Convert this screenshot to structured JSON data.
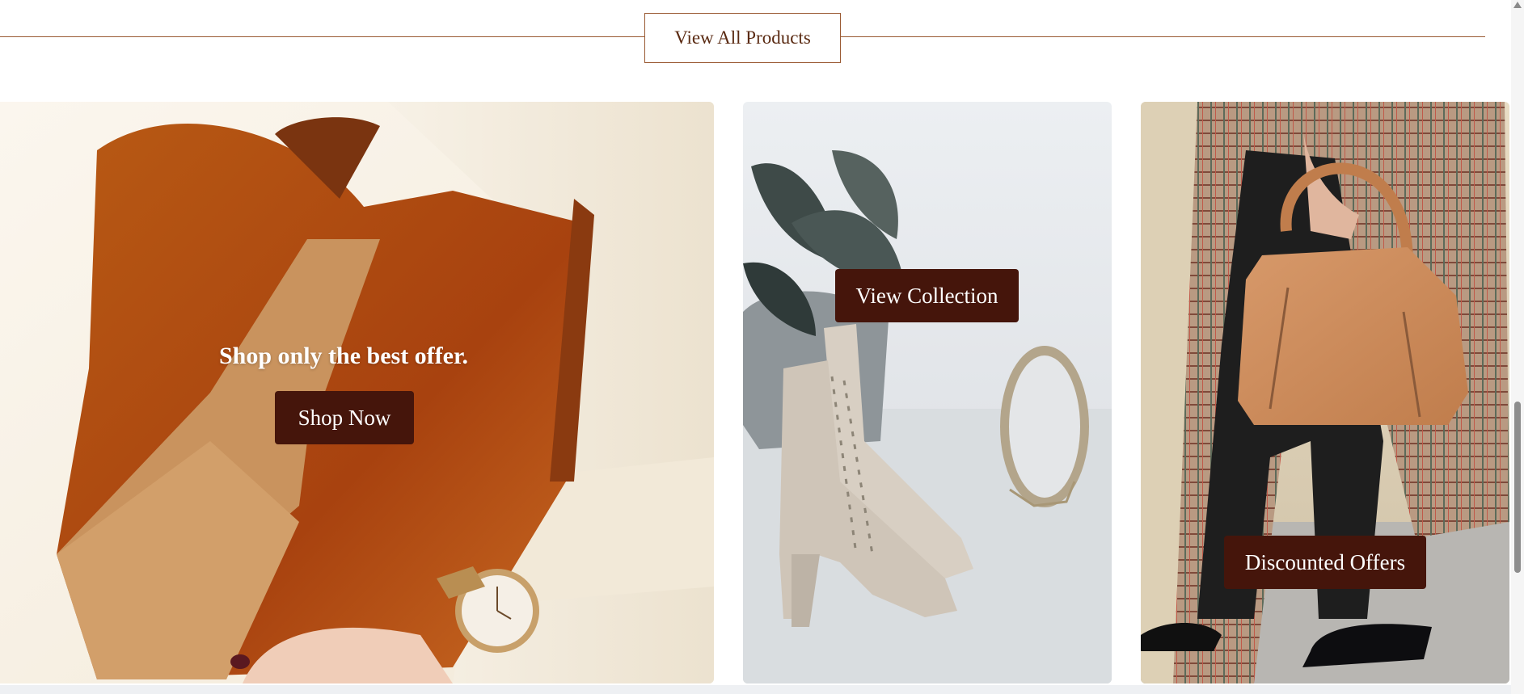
{
  "section": {
    "view_all_label": "View All Products"
  },
  "cards": [
    {
      "id": "best-offer",
      "title": "Shop only the best offer.",
      "button_label": "Shop Now",
      "image": "bucket-bag-wristwatch-photo"
    },
    {
      "id": "collection",
      "button_label": "View Collection",
      "image": "suede-lace-up-boots-mirror-photo"
    },
    {
      "id": "discounts",
      "button_label": "Discounted Offers",
      "image": "tan-handbag-plaid-coat-photo"
    }
  ],
  "colors": {
    "accent": "#45150b",
    "divider": "#9a5a33",
    "text_brown": "#5a2a12"
  }
}
